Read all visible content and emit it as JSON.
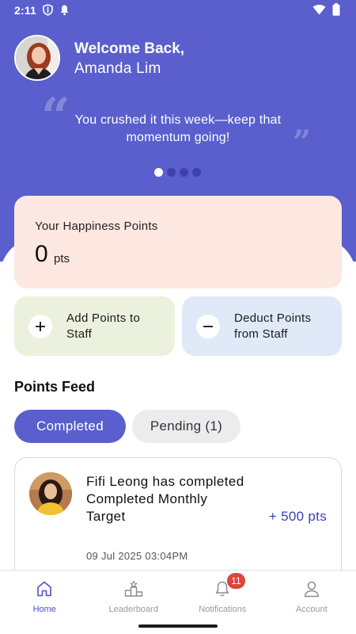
{
  "status_bar": {
    "time": "2:11"
  },
  "header": {
    "welcome_title": "Welcome Back,",
    "user_name": "Amanda Lim"
  },
  "quote": {
    "text": "You crushed it this week—keep that momentum going!",
    "carousel_total": 4,
    "carousel_active": 1
  },
  "points": {
    "label": "Your Happiness Points",
    "value": "0",
    "unit": "pts"
  },
  "actions": {
    "add_label": "Add Points to Staff",
    "deduct_label": "Deduct Points from Staff"
  },
  "feed": {
    "title": "Points Feed",
    "tabs": [
      {
        "label": "Completed",
        "active": true
      },
      {
        "label": "Pending (1)",
        "active": false
      }
    ],
    "items": [
      {
        "text": "Fifi Leong has completed Completed Monthly Target",
        "points": "+ 500 pts",
        "date": "09 Jul 2025 03:04PM"
      }
    ]
  },
  "nav": {
    "items": [
      {
        "label": "Home",
        "icon": "home-icon",
        "active": true
      },
      {
        "label": "Leaderboard",
        "icon": "leaderboard-icon",
        "active": false
      },
      {
        "label": "Notifications",
        "icon": "bell-icon",
        "active": false,
        "badge": "11"
      },
      {
        "label": "Account",
        "icon": "account-icon",
        "active": false
      }
    ]
  },
  "colors": {
    "primary": "#5a5fcd",
    "points_card": "#fde8e1",
    "add_card": "#ecf1dd",
    "deduct_card": "#dfe9f7",
    "points_text": "#3a42b5",
    "badge": "#e2433a"
  }
}
